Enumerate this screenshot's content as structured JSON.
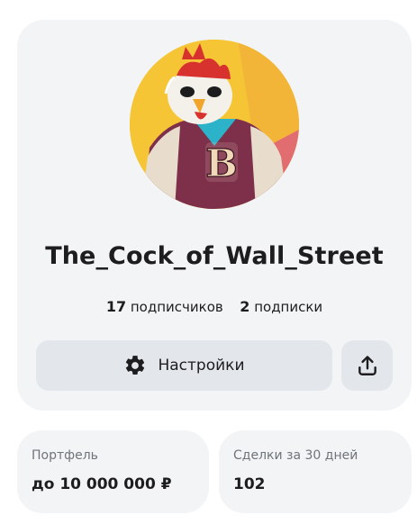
{
  "profile": {
    "username": "The_Cock_of_Wall_Street",
    "followers_count": "17",
    "followers_label": "подписчиков",
    "following_count": "2",
    "following_label": "подписки",
    "avatar_letter": "B"
  },
  "actions": {
    "settings_label": "Настройки",
    "settings_icon": "gear-icon",
    "share_icon": "share-icon"
  },
  "stats": {
    "portfolio": {
      "label": "Портфель",
      "value": "до 10 000 000 ₽"
    },
    "deals": {
      "label": "Сделки за 30 дней",
      "value": "102"
    }
  },
  "colors": {
    "card_background": "#f2f4f6",
    "button_background": "#e3e6ea",
    "text_primary": "#1d1d1f",
    "text_secondary": "#6f7479",
    "avatar_background": "#f5c535"
  }
}
